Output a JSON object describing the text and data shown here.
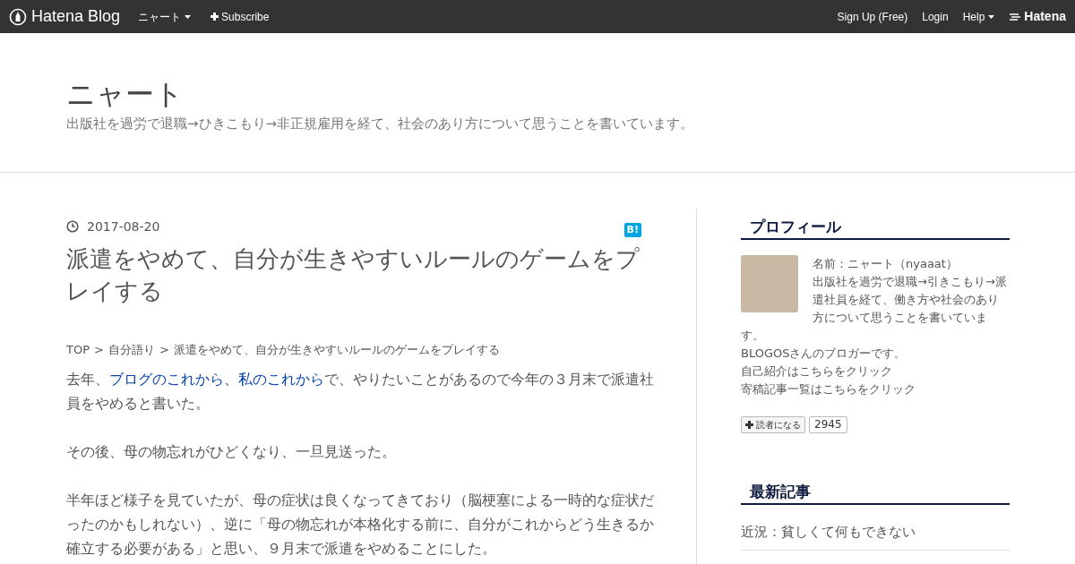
{
  "topbar": {
    "brand": "Hatena Blog",
    "blog_menu": "ニャート",
    "subscribe": "Subscribe",
    "signup": "Sign Up (Free)",
    "login": "Login",
    "help": "Help",
    "hatena": "Hatena"
  },
  "header": {
    "title": "ニャート",
    "tagline": "出版社を過労で退職→ひきこもり→非正規雇用を経て、社会のあり方について思うことを書いています。"
  },
  "article": {
    "date": "2017-08-20",
    "bookmark": "B!",
    "title": "派遣をやめて、自分が生きやすいルールのゲームをプレイする",
    "breadcrumbs": [
      "TOP",
      "自分語り",
      "派遣をやめて、自分が生きやすいルールのゲームをプレイする"
    ],
    "breadcrumb_separator": ">",
    "paragraphs": [
      [
        {
          "kind": "text",
          "text": "去年、"
        },
        {
          "kind": "link",
          "text": "ブログのこれから、私のこれから"
        },
        {
          "kind": "text",
          "text": "で、やりたいことがあるので今年の３月末で派遣社員をやめると書いた。"
        }
      ],
      [
        {
          "kind": "text",
          "text": "その後、母の物忘れがひどくなり、一旦見送った。"
        }
      ],
      [
        {
          "kind": "text",
          "text": "半年ほど様子を見ていたが、母の症状は良くなってきており（脳梗塞による一時的な症状だったのかもしれない）、逆に「母の物忘れが本格化する前に、自分がこれからどう生きるか確立する必要がある」と思い、９月末で派遣をやめることにした。"
        }
      ]
    ]
  },
  "sidebar": {
    "profile": {
      "heading": "プロフィール",
      "name": "名前：ニャート（nyaaat）",
      "description": "出版社を過労で退職→引きこもり→派遣社員を経て、働き方や社会のあり方について思うことを書いていま",
      "description_end": "す。",
      "lines": [
        "BLOGOSさんのブロガーです。",
        "自己紹介はこちらをクリック",
        "寄稿記事一覧はこちらをクリック"
      ],
      "follow": "読者になる",
      "count": "2945"
    },
    "recent": {
      "heading": "最新記事",
      "items": [
        "近況：貧しくて何もできない"
      ]
    }
  }
}
